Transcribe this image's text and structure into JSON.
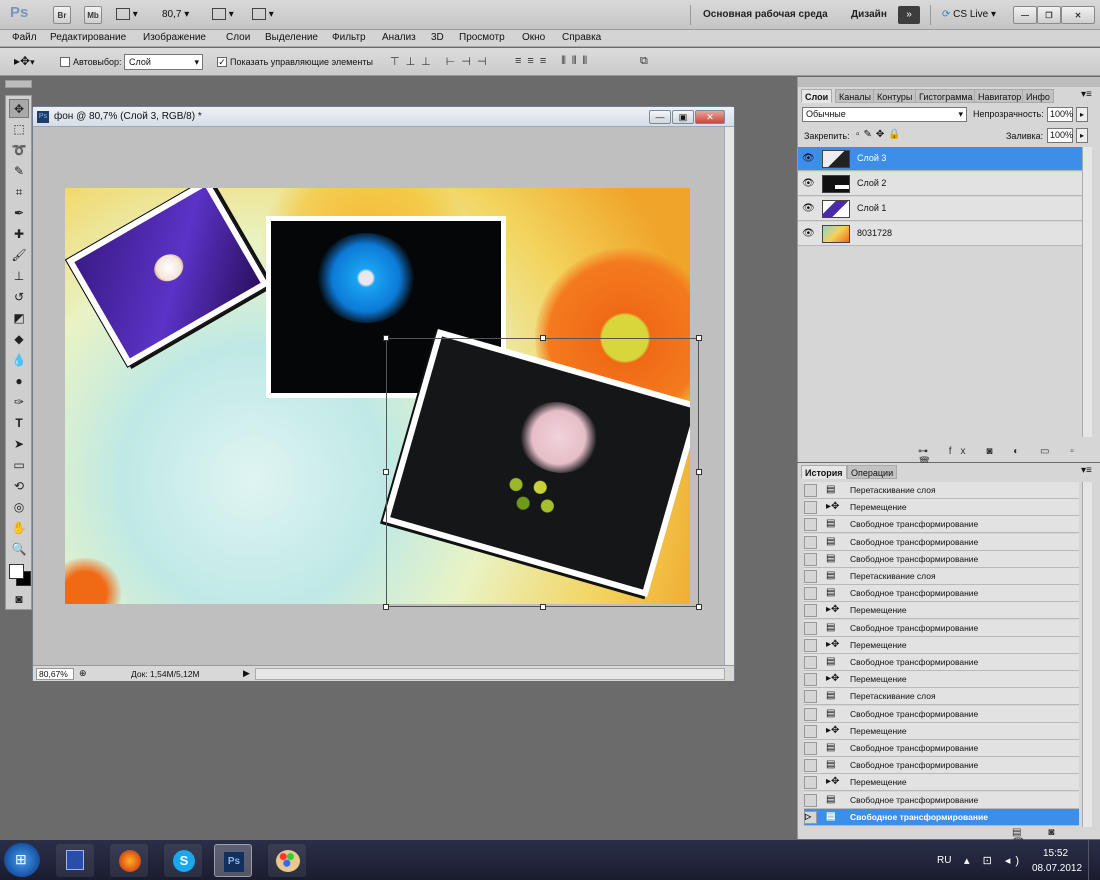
{
  "appbar": {
    "logo": "Ps",
    "br": "Br",
    "mb": "Mb",
    "zoom": "80,7",
    "workspace": "Основная рабочая среда",
    "design": "Дизайн",
    "cslive": "CS Live"
  },
  "menu": [
    "Файл",
    "Редактирование",
    "Изображение",
    "Слои",
    "Выделение",
    "Фильтр",
    "Анализ",
    "3D",
    "Просмотр",
    "Окно",
    "Справка"
  ],
  "options": {
    "autoselect_label": "Автовыбор:",
    "autoselect_value": "Слой",
    "show_controls": "Показать управляющие элементы"
  },
  "document": {
    "title": "фон @ 80,7% (Слой 3, RGB/8) *",
    "zoom": "80,67%",
    "doc_size": "Док: 1,54M/5,12M"
  },
  "layers_panel": {
    "tabs": [
      "Слои",
      "Каналы",
      "Контуры",
      "Гистограмма",
      "Навигатор",
      "Инфо"
    ],
    "blend_mode": "Обычные",
    "opacity_label": "Непрозрачность:",
    "opacity": "100%",
    "lock_label": "Закрепить:",
    "fill_label": "Заливка:",
    "fill": "100%",
    "layers": [
      {
        "name": "Слой 3",
        "selected": true
      },
      {
        "name": "Слой 2",
        "selected": false
      },
      {
        "name": "Слой 1",
        "selected": false
      },
      {
        "name": "8031728",
        "selected": false
      }
    ]
  },
  "history_panel": {
    "tabs": [
      "История",
      "Операции"
    ],
    "items": [
      "Перетаскивание слоя",
      "Перемещение",
      "Свободное трансформирование",
      "Свободное трансформирование",
      "Свободное трансформирование",
      "Перетаскивание слоя",
      "Свободное трансформирование",
      "Перемещение",
      "Свободное трансформирование",
      "Перемещение",
      "Свободное трансформирование",
      "Перемещение",
      "Перетаскивание слоя",
      "Свободное трансформирование",
      "Перемещение",
      "Свободное трансформирование",
      "Свободное трансформирование",
      "Перемещение",
      "Свободное трансформирование",
      "Свободное трансформирование"
    ]
  },
  "taskbar": {
    "lang": "RU",
    "time": "15:52",
    "date": "08.07.2012"
  }
}
